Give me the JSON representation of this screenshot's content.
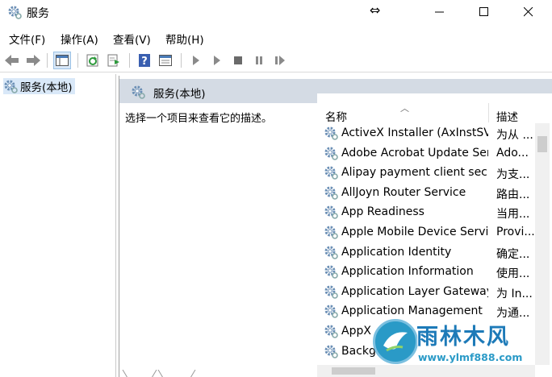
{
  "window": {
    "title": "服务"
  },
  "menu": {
    "file": "文件(F)",
    "action": "操作(A)",
    "view": "查看(V)",
    "help": "帮助(H)"
  },
  "tree": {
    "root_label": "服务(本地)"
  },
  "main": {
    "header_title": "服务(本地)",
    "description_prompt": "选择一个项目来查看它的描述。"
  },
  "list": {
    "columns": {
      "name": "名称",
      "description": "描述"
    },
    "rows": [
      {
        "name": "ActiveX Installer (AxInstSV)",
        "desc": "为从 ..."
      },
      {
        "name": "Adobe Acrobat Update Ser...",
        "desc": "Ado..."
      },
      {
        "name": "Alipay payment client secu...",
        "desc": "为支..."
      },
      {
        "name": "AllJoyn Router Service",
        "desc": "路由..."
      },
      {
        "name": "App Readiness",
        "desc": "当用..."
      },
      {
        "name": "Apple Mobile Device Servi...",
        "desc": "Provi..."
      },
      {
        "name": "Application Identity",
        "desc": "确定..."
      },
      {
        "name": "Application Information",
        "desc": "使用..."
      },
      {
        "name": "Application Layer Gateway ...",
        "desc": "为 In..."
      },
      {
        "name": "Application Management",
        "desc": "为通..."
      },
      {
        "name": "AppX",
        "desc": ""
      },
      {
        "name": "Backg",
        "desc": ""
      }
    ]
  },
  "watermark": {
    "title": "雨林木风",
    "url": "www.ylmf888.com"
  },
  "colors": {
    "header_bg": "#d4dbe4",
    "selection": "#d9e8f8",
    "watermark_blue": "#1d7ab8"
  }
}
